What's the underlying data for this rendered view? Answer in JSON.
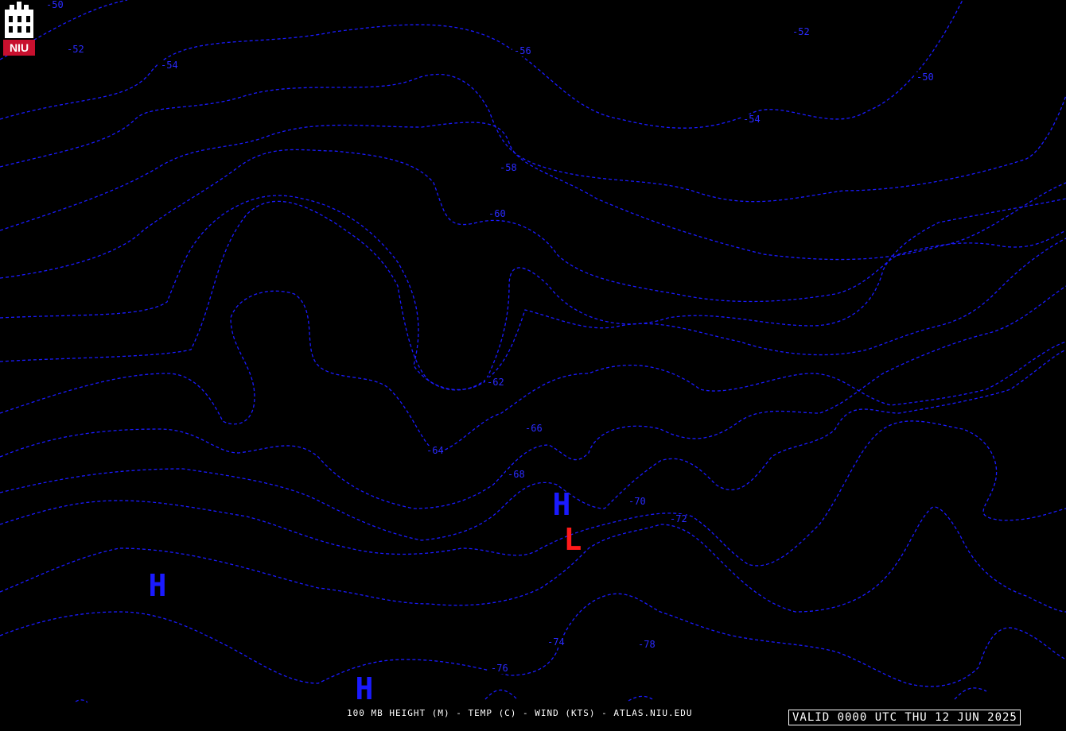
{
  "map": {
    "footer_caption": "100 MB HEIGHT (M) - TEMP (C) - WIND (KTS) - ATLAS.NIU.EDU",
    "valid_time": "VALID 0000 UTC THU 12 JUN 2025",
    "logo_text": "NIU",
    "colors": {
      "background": "#000000",
      "contour": "#1a1aff",
      "high_marker": "#1a1aff",
      "low_marker": "#ff1a1a",
      "text": "#ffffff"
    },
    "contour_labels": [
      "-50",
      "-52",
      "-54",
      "-56",
      "-52",
      "-50",
      "-54",
      "-58",
      "-60",
      "-62",
      "-64",
      "-66",
      "-68",
      "-70",
      "-72",
      "-74",
      "-76",
      "-78"
    ],
    "pressure_centers": [
      {
        "type": "H",
        "color_key": "high_marker"
      },
      {
        "type": "H",
        "color_key": "high_marker"
      },
      {
        "type": "H",
        "color_key": "high_marker"
      },
      {
        "type": "L",
        "color_key": "low_marker"
      }
    ]
  }
}
